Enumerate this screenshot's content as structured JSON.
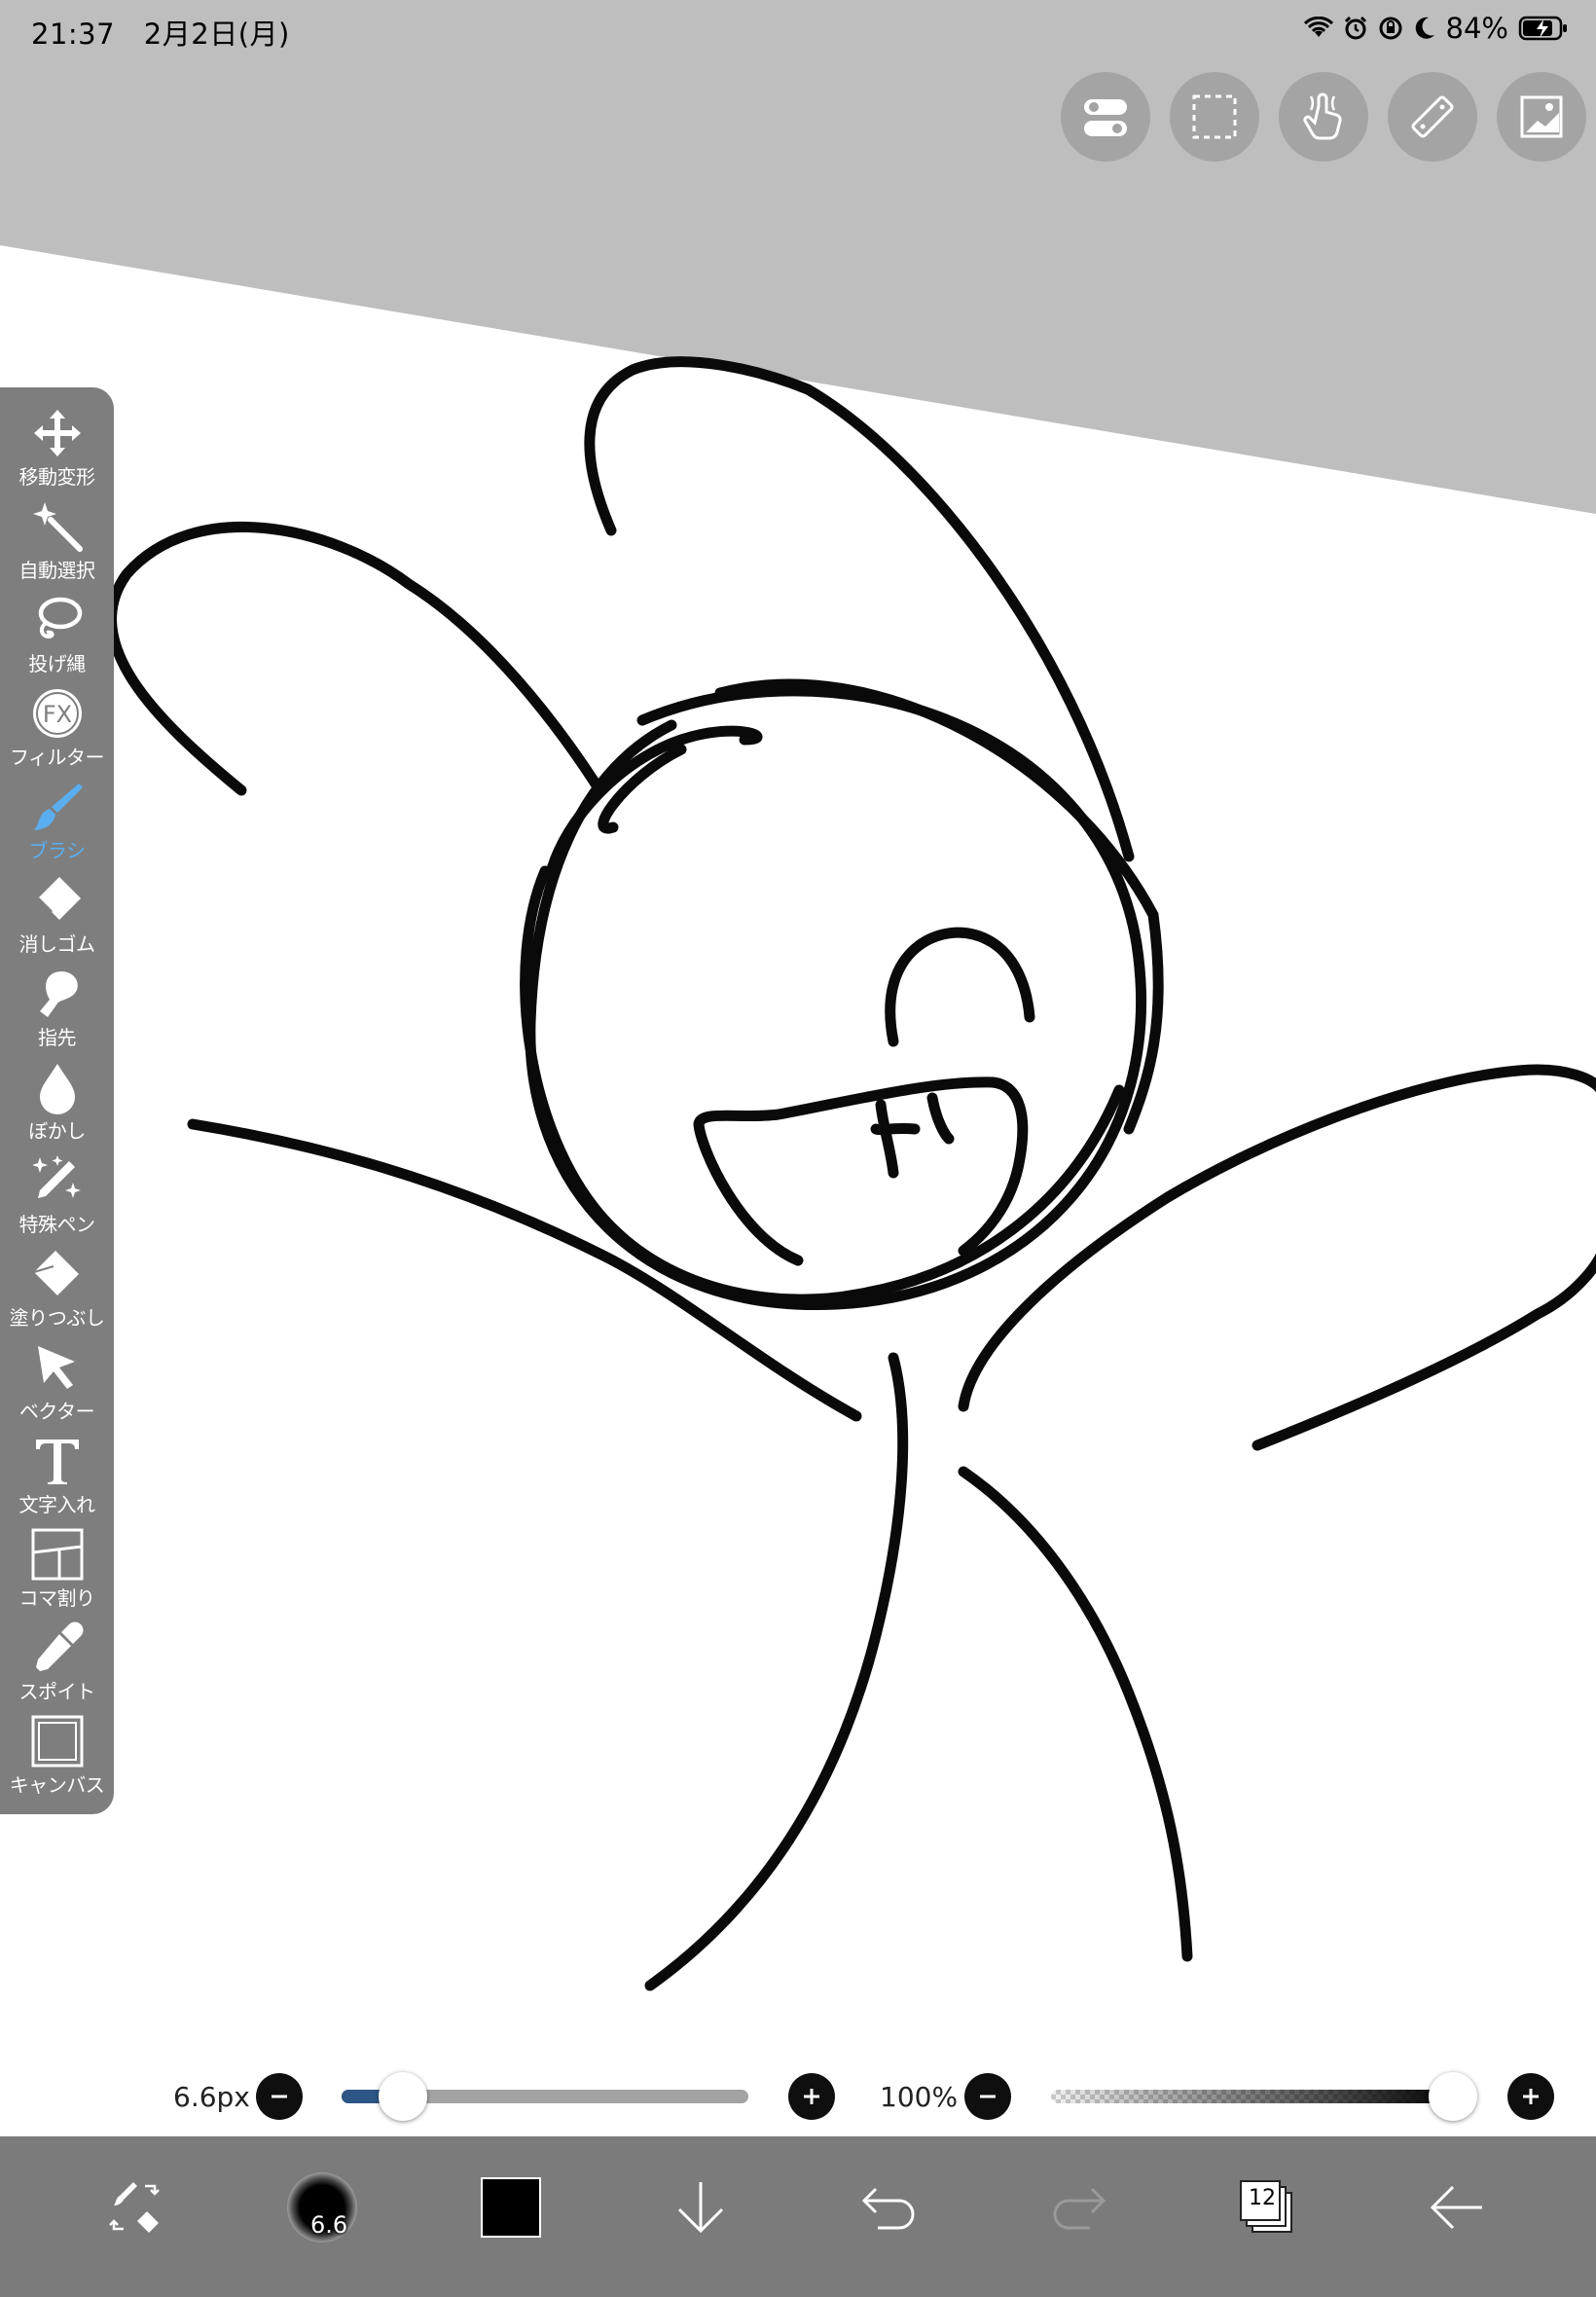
{
  "status_bar": {
    "time": "21:37",
    "date": "2月2日(月)",
    "battery": "84%"
  },
  "top_toolbar": {
    "items": [
      {
        "name": "quick-access-toggle",
        "icon": "toggle-switch-icon"
      },
      {
        "name": "selection",
        "icon": "dashed-selection-icon"
      },
      {
        "name": "gesture",
        "icon": "hand-touch-icon"
      },
      {
        "name": "ruler",
        "icon": "ruler-icon"
      },
      {
        "name": "material",
        "icon": "image-icon"
      }
    ]
  },
  "left_toolbar": {
    "tools": [
      {
        "label": "移動変形",
        "icon": "move-arrows-icon",
        "active": false
      },
      {
        "label": "自動選択",
        "icon": "magic-wand-icon",
        "active": false
      },
      {
        "label": "投げ縄",
        "icon": "lasso-icon",
        "active": false
      },
      {
        "label": "フィルター",
        "icon": "fx-icon",
        "active": false
      },
      {
        "label": "ブラシ",
        "icon": "brush-icon",
        "active": true
      },
      {
        "label": "消しゴム",
        "icon": "eraser-icon",
        "active": false
      },
      {
        "label": "指先",
        "icon": "finger-icon",
        "active": false
      },
      {
        "label": "ぼかし",
        "icon": "drop-icon",
        "active": false
      },
      {
        "label": "特殊ペン",
        "icon": "sparkle-pen-icon",
        "active": false
      },
      {
        "label": "塗りつぶし",
        "icon": "fill-bucket-icon",
        "active": false
      },
      {
        "label": "ベクター",
        "icon": "vector-arrow-icon",
        "active": false
      },
      {
        "label": "文字入れ",
        "icon": "text-t-icon",
        "active": false
      },
      {
        "label": "コマ割り",
        "icon": "frame-divide-icon",
        "active": false
      },
      {
        "label": "スポイト",
        "icon": "eyedropper-icon",
        "active": false
      },
      {
        "label": "キャンバス",
        "icon": "canvas-icon",
        "active": false
      }
    ]
  },
  "brush_settings": {
    "size_label": "6.6px",
    "size_fraction": 0.15,
    "opacity_label": "100%",
    "opacity_fraction": 1.0
  },
  "bottom_bar": {
    "brush_size_badge": "6.6",
    "current_color": "#000000",
    "layer_count": "12"
  },
  "colors": {
    "ui_gray": "#7b7b7b",
    "background_gray": "#bebebe",
    "accent_blue": "#5aaef0",
    "slider_fill": "#2d5585"
  }
}
